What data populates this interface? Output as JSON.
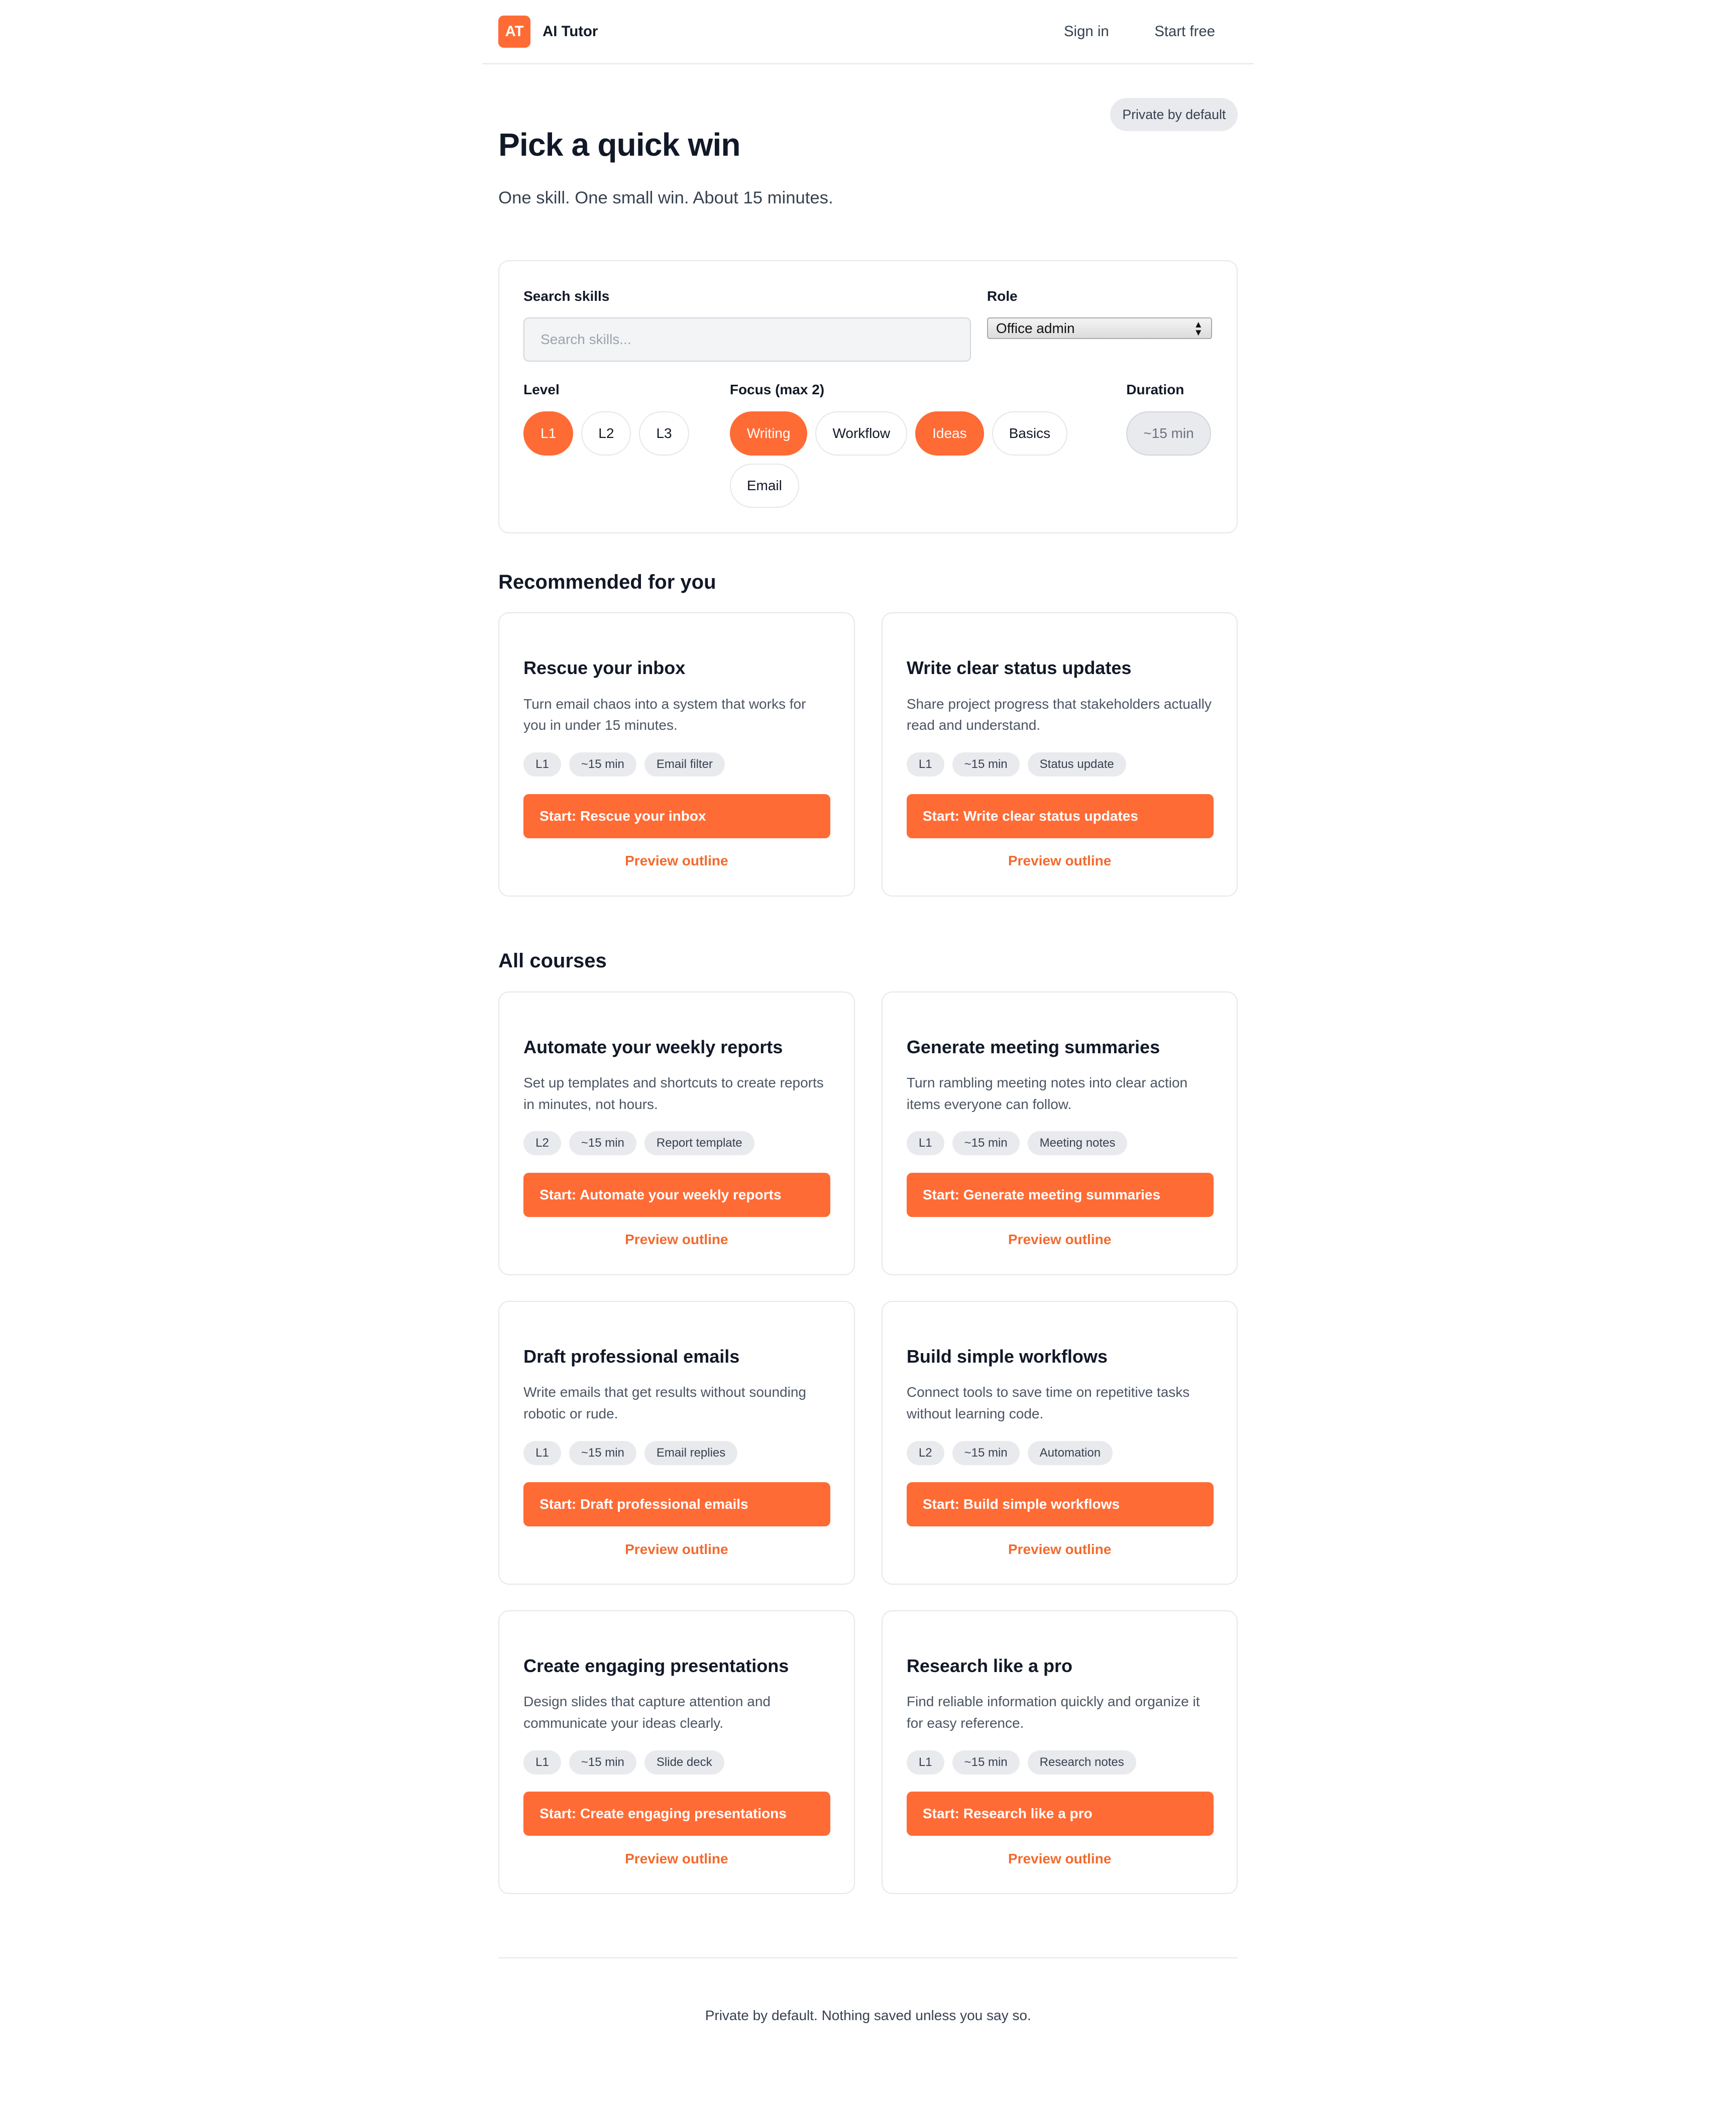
{
  "header": {
    "logo": "AT",
    "brand": "AI Tutor",
    "sign_in": "Sign in",
    "start_free": "Start free"
  },
  "hero": {
    "privacy_pill": "Private by default",
    "title": "Pick a quick win",
    "subtitle": "One skill. One small win. About 15 minutes."
  },
  "filters": {
    "search_label": "Search skills",
    "search_placeholder": "Search skills...",
    "search_value": "",
    "role_label": "Role",
    "role_value": "Office admin",
    "level_label": "Level",
    "levels": [
      {
        "label": "L1",
        "active": true
      },
      {
        "label": "L2",
        "active": false
      },
      {
        "label": "L3",
        "active": false
      }
    ],
    "focus_label": "Focus (max 2)",
    "focus": [
      {
        "label": "Writing",
        "active": true
      },
      {
        "label": "Workflow",
        "active": false
      },
      {
        "label": "Ideas",
        "active": true
      },
      {
        "label": "Basics",
        "active": false
      },
      {
        "label": "Email",
        "active": false
      }
    ],
    "duration_label": "Duration",
    "duration_value": "~15 min"
  },
  "recommended": {
    "title": "Recommended for you",
    "cards": [
      {
        "title": "Rescue your inbox",
        "desc": "Turn email chaos into a system that works for you in under 15 minutes.",
        "tags": [
          "L1",
          "~15 min",
          "Email filter"
        ],
        "start": "Start: Rescue your inbox",
        "preview": "Preview outline"
      },
      {
        "title": "Write clear status updates",
        "desc": "Share project progress that stakeholders actually read and understand.",
        "tags": [
          "L1",
          "~15 min",
          "Status update"
        ],
        "start": "Start: Write clear status updates",
        "preview": "Preview outline"
      }
    ]
  },
  "all": {
    "title": "All courses",
    "cards": [
      {
        "title": "Automate your weekly reports",
        "desc": "Set up templates and shortcuts to create reports in minutes, not hours.",
        "tags": [
          "L2",
          "~15 min",
          "Report template"
        ],
        "start": "Start: Automate your weekly reports",
        "preview": "Preview outline"
      },
      {
        "title": "Generate meeting summaries",
        "desc": "Turn rambling meeting notes into clear action items everyone can follow.",
        "tags": [
          "L1",
          "~15 min",
          "Meeting notes"
        ],
        "start": "Start: Generate meeting summaries",
        "preview": "Preview outline"
      },
      {
        "title": "Draft professional emails",
        "desc": "Write emails that get results without sounding robotic or rude.",
        "tags": [
          "L1",
          "~15 min",
          "Email replies"
        ],
        "start": "Start: Draft professional emails",
        "preview": "Preview outline"
      },
      {
        "title": "Build simple workflows",
        "desc": "Connect tools to save time on repetitive tasks without learning code.",
        "tags": [
          "L2",
          "~15 min",
          "Automation"
        ],
        "start": "Start: Build simple workflows",
        "preview": "Preview outline"
      },
      {
        "title": "Create engaging presentations",
        "desc": "Design slides that capture attention and communicate your ideas clearly.",
        "tags": [
          "L1",
          "~15 min",
          "Slide deck"
        ],
        "start": "Start: Create engaging presentations",
        "preview": "Preview outline"
      },
      {
        "title": "Research like a pro",
        "desc": "Find reliable information quickly and organize it for easy reference.",
        "tags": [
          "L1",
          "~15 min",
          "Research notes"
        ],
        "start": "Start: Research like a pro",
        "preview": "Preview outline"
      }
    ]
  },
  "footer": {
    "text": "Private by default. Nothing saved unless you say so."
  },
  "colors": {
    "accent": "#ff6b35",
    "pill_bg": "#e9eaee",
    "border": "#e5e7eb"
  }
}
